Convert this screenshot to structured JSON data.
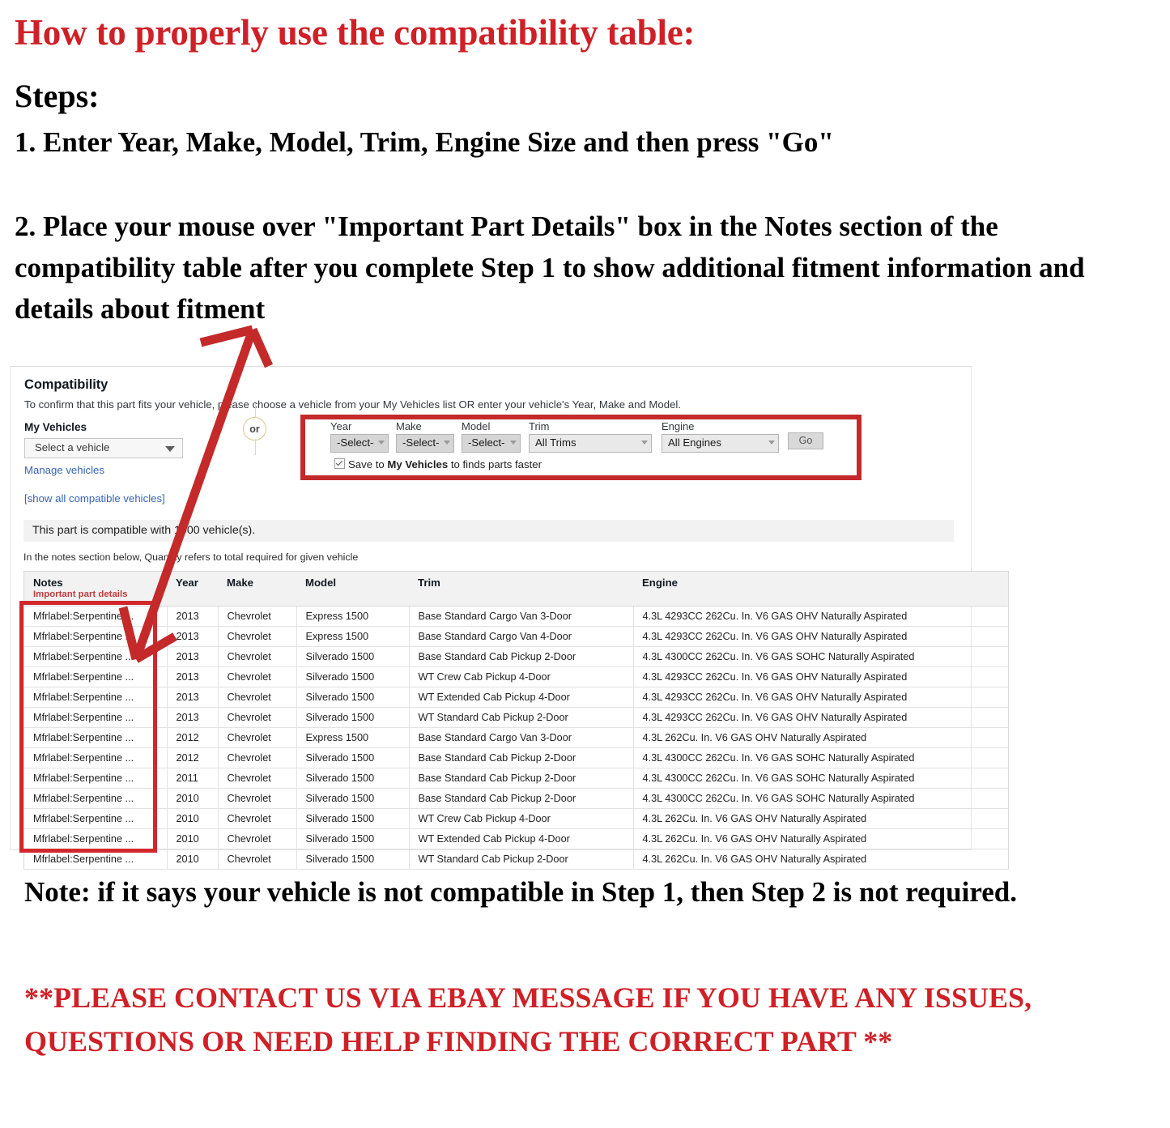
{
  "headline": "How to properly use the compatibility table:",
  "steps_label": "Steps:",
  "step1": "1. Enter Year, Make, Model, Trim, Engine Size and then press \"Go\"",
  "step2": "2. Place your mouse over \"Important Part Details\" box in the Notes section of the compatibility table after you complete Step 1 to show additional fitment information and details about fitment",
  "note": "Note: if it says your vehicle is not compatible in Step 1, then Step 2 is not required.",
  "contact": "**PLEASE CONTACT US VIA EBAY MESSAGE IF YOU HAVE ANY ISSUES, QUESTIONS OR NEED HELP FINDING THE CORRECT PART **",
  "colors": {
    "red_accent": "#cf2027",
    "annotation_red": "#c42a2a",
    "link_blue": "#3665b3",
    "or_gold": "#d9c98e"
  },
  "panel": {
    "title": "Compatibility",
    "subtitle": "To confirm that this part fits your vehicle, please choose a vehicle from your My Vehicles list OR enter your vehicle's Year, Make and Model.",
    "my_vehicles_label": "My Vehicles",
    "vehicle_select_value": "Select a vehicle",
    "manage_vehicles_link": "Manage vehicles",
    "show_all_link": "[show all compatible vehicles]",
    "or_divider": "or",
    "selectors": [
      {
        "label": "Year",
        "value": "-Select-",
        "style": "dark"
      },
      {
        "label": "Make",
        "value": "-Select-",
        "style": "dark"
      },
      {
        "label": "Model",
        "value": "-Select-",
        "style": "dark"
      },
      {
        "label": "Trim",
        "value": "All Trims",
        "style": "light"
      },
      {
        "label": "Engine",
        "value": "All Engines",
        "style": "light"
      }
    ],
    "go_button": "Go",
    "save_checkbox": {
      "checked": true,
      "prefix": "Save to ",
      "bold": "My Vehicles",
      "suffix": " to finds parts faster"
    },
    "result_bar": "This part is compatible with 1000 vehicle(s).",
    "notes_hint": "In the notes section below, Quantity refers to total required for given vehicle"
  },
  "table": {
    "headers": {
      "notes": "Notes",
      "notes_sub": "Important part details",
      "year": "Year",
      "make": "Make",
      "model": "Model",
      "trim": "Trim",
      "engine": "Engine"
    },
    "rows": [
      {
        "notes": "Mfrlabel:Serpentine ...",
        "year": "2013",
        "make": "Chevrolet",
        "model": "Express 1500",
        "trim": "Base Standard Cargo Van 3-Door",
        "engine": "4.3L 4293CC 262Cu. In. V6 GAS OHV Naturally Aspirated"
      },
      {
        "notes": "Mfrlabel:Serpentine ...",
        "year": "2013",
        "make": "Chevrolet",
        "model": "Express 1500",
        "trim": "Base Standard Cargo Van 4-Door",
        "engine": "4.3L 4293CC 262Cu. In. V6 GAS OHV Naturally Aspirated"
      },
      {
        "notes": "Mfrlabel:Serpentine ...",
        "year": "2013",
        "make": "Chevrolet",
        "model": "Silverado 1500",
        "trim": "Base Standard Cab Pickup 2-Door",
        "engine": "4.3L 4300CC 262Cu. In. V6 GAS SOHC Naturally Aspirated"
      },
      {
        "notes": "Mfrlabel:Serpentine ...",
        "year": "2013",
        "make": "Chevrolet",
        "model": "Silverado 1500",
        "trim": "WT Crew Cab Pickup 4-Door",
        "engine": "4.3L 4293CC 262Cu. In. V6 GAS OHV Naturally Aspirated"
      },
      {
        "notes": "Mfrlabel:Serpentine ...",
        "year": "2013",
        "make": "Chevrolet",
        "model": "Silverado 1500",
        "trim": "WT Extended Cab Pickup 4-Door",
        "engine": "4.3L 4293CC 262Cu. In. V6 GAS OHV Naturally Aspirated"
      },
      {
        "notes": "Mfrlabel:Serpentine ...",
        "year": "2013",
        "make": "Chevrolet",
        "model": "Silverado 1500",
        "trim": "WT Standard Cab Pickup 2-Door",
        "engine": "4.3L 4293CC 262Cu. In. V6 GAS OHV Naturally Aspirated"
      },
      {
        "notes": "Mfrlabel:Serpentine ...",
        "year": "2012",
        "make": "Chevrolet",
        "model": "Express 1500",
        "trim": "Base Standard Cargo Van 3-Door",
        "engine": "4.3L 262Cu. In. V6 GAS OHV Naturally Aspirated"
      },
      {
        "notes": "Mfrlabel:Serpentine ...",
        "year": "2012",
        "make": "Chevrolet",
        "model": "Silverado 1500",
        "trim": "Base Standard Cab Pickup 2-Door",
        "engine": "4.3L 4300CC 262Cu. In. V6 GAS SOHC Naturally Aspirated"
      },
      {
        "notes": "Mfrlabel:Serpentine ...",
        "year": "2011",
        "make": "Chevrolet",
        "model": "Silverado 1500",
        "trim": "Base Standard Cab Pickup 2-Door",
        "engine": "4.3L 4300CC 262Cu. In. V6 GAS SOHC Naturally Aspirated"
      },
      {
        "notes": "Mfrlabel:Serpentine ...",
        "year": "2010",
        "make": "Chevrolet",
        "model": "Silverado 1500",
        "trim": "Base Standard Cab Pickup 2-Door",
        "engine": "4.3L 4300CC 262Cu. In. V6 GAS SOHC Naturally Aspirated"
      },
      {
        "notes": "Mfrlabel:Serpentine ...",
        "year": "2010",
        "make": "Chevrolet",
        "model": "Silverado 1500",
        "trim": "WT Crew Cab Pickup 4-Door",
        "engine": "4.3L 262Cu. In. V6 GAS OHV Naturally Aspirated"
      },
      {
        "notes": "Mfrlabel:Serpentine ...",
        "year": "2010",
        "make": "Chevrolet",
        "model": "Silverado 1500",
        "trim": "WT Extended Cab Pickup 4-Door",
        "engine": "4.3L 262Cu. In. V6 GAS OHV Naturally Aspirated"
      },
      {
        "notes": "Mfrlabel:Serpentine ...",
        "year": "2010",
        "make": "Chevrolet",
        "model": "Silverado 1500",
        "trim": "WT Standard Cab Pickup 2-Door",
        "engine": "4.3L 262Cu. In. V6 GAS OHV Naturally Aspirated"
      }
    ]
  }
}
